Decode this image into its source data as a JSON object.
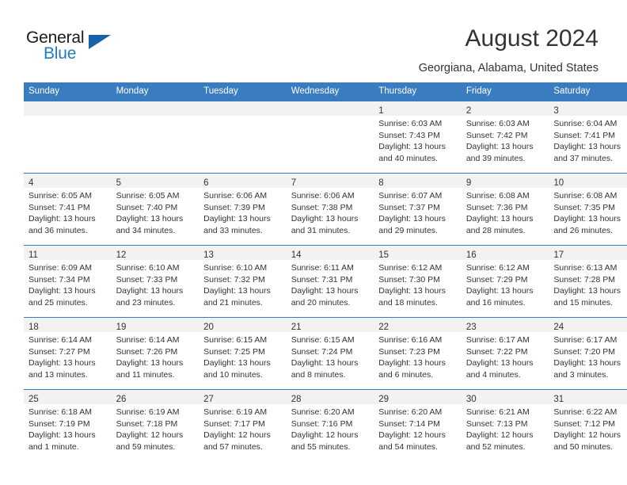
{
  "brand": {
    "name_top": "General",
    "name_bottom": "Blue",
    "accent_color": "#1f7bc1",
    "triangle_color": "#1763a6"
  },
  "header": {
    "title": "August 2024",
    "subtitle": "Georgiana, Alabama, United States",
    "header_bg": "#3a7cc0"
  },
  "calendar": {
    "weekday_headers": [
      "Sunday",
      "Monday",
      "Tuesday",
      "Wednesday",
      "Thursday",
      "Friday",
      "Saturday"
    ],
    "weeks": [
      [
        {
          "day": "",
          "lines": []
        },
        {
          "day": "",
          "lines": []
        },
        {
          "day": "",
          "lines": []
        },
        {
          "day": "",
          "lines": []
        },
        {
          "day": "1",
          "lines": [
            "Sunrise: 6:03 AM",
            "Sunset: 7:43 PM",
            "Daylight: 13 hours",
            "and 40 minutes."
          ]
        },
        {
          "day": "2",
          "lines": [
            "Sunrise: 6:03 AM",
            "Sunset: 7:42 PM",
            "Daylight: 13 hours",
            "and 39 minutes."
          ]
        },
        {
          "day": "3",
          "lines": [
            "Sunrise: 6:04 AM",
            "Sunset: 7:41 PM",
            "Daylight: 13 hours",
            "and 37 minutes."
          ]
        }
      ],
      [
        {
          "day": "4",
          "lines": [
            "Sunrise: 6:05 AM",
            "Sunset: 7:41 PM",
            "Daylight: 13 hours",
            "and 36 minutes."
          ]
        },
        {
          "day": "5",
          "lines": [
            "Sunrise: 6:05 AM",
            "Sunset: 7:40 PM",
            "Daylight: 13 hours",
            "and 34 minutes."
          ]
        },
        {
          "day": "6",
          "lines": [
            "Sunrise: 6:06 AM",
            "Sunset: 7:39 PM",
            "Daylight: 13 hours",
            "and 33 minutes."
          ]
        },
        {
          "day": "7",
          "lines": [
            "Sunrise: 6:06 AM",
            "Sunset: 7:38 PM",
            "Daylight: 13 hours",
            "and 31 minutes."
          ]
        },
        {
          "day": "8",
          "lines": [
            "Sunrise: 6:07 AM",
            "Sunset: 7:37 PM",
            "Daylight: 13 hours",
            "and 29 minutes."
          ]
        },
        {
          "day": "9",
          "lines": [
            "Sunrise: 6:08 AM",
            "Sunset: 7:36 PM",
            "Daylight: 13 hours",
            "and 28 minutes."
          ]
        },
        {
          "day": "10",
          "lines": [
            "Sunrise: 6:08 AM",
            "Sunset: 7:35 PM",
            "Daylight: 13 hours",
            "and 26 minutes."
          ]
        }
      ],
      [
        {
          "day": "11",
          "lines": [
            "Sunrise: 6:09 AM",
            "Sunset: 7:34 PM",
            "Daylight: 13 hours",
            "and 25 minutes."
          ]
        },
        {
          "day": "12",
          "lines": [
            "Sunrise: 6:10 AM",
            "Sunset: 7:33 PM",
            "Daylight: 13 hours",
            "and 23 minutes."
          ]
        },
        {
          "day": "13",
          "lines": [
            "Sunrise: 6:10 AM",
            "Sunset: 7:32 PM",
            "Daylight: 13 hours",
            "and 21 minutes."
          ]
        },
        {
          "day": "14",
          "lines": [
            "Sunrise: 6:11 AM",
            "Sunset: 7:31 PM",
            "Daylight: 13 hours",
            "and 20 minutes."
          ]
        },
        {
          "day": "15",
          "lines": [
            "Sunrise: 6:12 AM",
            "Sunset: 7:30 PM",
            "Daylight: 13 hours",
            "and 18 minutes."
          ]
        },
        {
          "day": "16",
          "lines": [
            "Sunrise: 6:12 AM",
            "Sunset: 7:29 PM",
            "Daylight: 13 hours",
            "and 16 minutes."
          ]
        },
        {
          "day": "17",
          "lines": [
            "Sunrise: 6:13 AM",
            "Sunset: 7:28 PM",
            "Daylight: 13 hours",
            "and 15 minutes."
          ]
        }
      ],
      [
        {
          "day": "18",
          "lines": [
            "Sunrise: 6:14 AM",
            "Sunset: 7:27 PM",
            "Daylight: 13 hours",
            "and 13 minutes."
          ]
        },
        {
          "day": "19",
          "lines": [
            "Sunrise: 6:14 AM",
            "Sunset: 7:26 PM",
            "Daylight: 13 hours",
            "and 11 minutes."
          ]
        },
        {
          "day": "20",
          "lines": [
            "Sunrise: 6:15 AM",
            "Sunset: 7:25 PM",
            "Daylight: 13 hours",
            "and 10 minutes."
          ]
        },
        {
          "day": "21",
          "lines": [
            "Sunrise: 6:15 AM",
            "Sunset: 7:24 PM",
            "Daylight: 13 hours",
            "and 8 minutes."
          ]
        },
        {
          "day": "22",
          "lines": [
            "Sunrise: 6:16 AM",
            "Sunset: 7:23 PM",
            "Daylight: 13 hours",
            "and 6 minutes."
          ]
        },
        {
          "day": "23",
          "lines": [
            "Sunrise: 6:17 AM",
            "Sunset: 7:22 PM",
            "Daylight: 13 hours",
            "and 4 minutes."
          ]
        },
        {
          "day": "24",
          "lines": [
            "Sunrise: 6:17 AM",
            "Sunset: 7:20 PM",
            "Daylight: 13 hours",
            "and 3 minutes."
          ]
        }
      ],
      [
        {
          "day": "25",
          "lines": [
            "Sunrise: 6:18 AM",
            "Sunset: 7:19 PM",
            "Daylight: 13 hours",
            "and 1 minute."
          ]
        },
        {
          "day": "26",
          "lines": [
            "Sunrise: 6:19 AM",
            "Sunset: 7:18 PM",
            "Daylight: 12 hours",
            "and 59 minutes."
          ]
        },
        {
          "day": "27",
          "lines": [
            "Sunrise: 6:19 AM",
            "Sunset: 7:17 PM",
            "Daylight: 12 hours",
            "and 57 minutes."
          ]
        },
        {
          "day": "28",
          "lines": [
            "Sunrise: 6:20 AM",
            "Sunset: 7:16 PM",
            "Daylight: 12 hours",
            "and 55 minutes."
          ]
        },
        {
          "day": "29",
          "lines": [
            "Sunrise: 6:20 AM",
            "Sunset: 7:14 PM",
            "Daylight: 12 hours",
            "and 54 minutes."
          ]
        },
        {
          "day": "30",
          "lines": [
            "Sunrise: 6:21 AM",
            "Sunset: 7:13 PM",
            "Daylight: 12 hours",
            "and 52 minutes."
          ]
        },
        {
          "day": "31",
          "lines": [
            "Sunrise: 6:22 AM",
            "Sunset: 7:12 PM",
            "Daylight: 12 hours",
            "and 50 minutes."
          ]
        }
      ]
    ]
  }
}
